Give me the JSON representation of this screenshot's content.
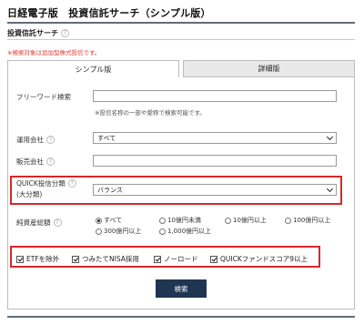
{
  "header": {
    "title": "日経電子版　投資信託サーチ（シンプル版）"
  },
  "section": {
    "subheading": "投資信託サーチ",
    "help_glyph": "?"
  },
  "notice": "※検索対象は追加型株式投信です。",
  "tabs": [
    {
      "label": "シンプル版",
      "active": true
    },
    {
      "label": "詳細版",
      "active": false
    }
  ],
  "form": {
    "keyword": {
      "label": "フリーワード検索",
      "value": "",
      "hint": "※投信名称の一部や愛称で検索可能です。"
    },
    "company": {
      "label": "運用会社",
      "help": "?",
      "selected": "すべて"
    },
    "distributor": {
      "label": "販売会社",
      "help": "?",
      "value": ""
    },
    "quick_category": {
      "label_line1": "QUICK投信分類",
      "label_line2": "(大分類)",
      "help": "?",
      "selected": "バランス"
    },
    "net_assets": {
      "label": "純資産総額",
      "help": "?",
      "options": [
        {
          "label": "すべて",
          "selected": true
        },
        {
          "label": "10億円未満",
          "selected": false
        },
        {
          "label": "10億円以上",
          "selected": false
        },
        {
          "label": "100億円以上",
          "selected": false
        },
        {
          "label": "300億円以上",
          "selected": false
        },
        {
          "label": "1,000億円以上",
          "selected": false
        }
      ]
    },
    "checkboxes": [
      {
        "label": "ETFを除外",
        "checked": true
      },
      {
        "label": "つみたてNISA採用",
        "checked": true
      },
      {
        "label": "ノーロード",
        "checked": true
      },
      {
        "label": "QUICKファンドスコア9以上",
        "checked": true
      }
    ],
    "search_label": "検索"
  },
  "colors": {
    "highlight": "#d62828",
    "button": "#1f3552",
    "notice": "#e63b2e",
    "rule": "#5f6d78"
  },
  "icons": {
    "help": "help-icon",
    "dropdown": "chevron-down-icon"
  }
}
